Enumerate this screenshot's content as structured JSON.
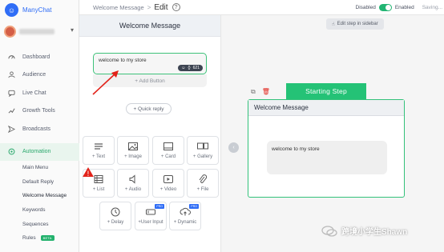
{
  "brand": {
    "name": "ManyChat"
  },
  "sidebar": {
    "nav": [
      {
        "label": "Dashboard",
        "icon": "dashboard-icon"
      },
      {
        "label": "Audience",
        "icon": "audience-icon"
      },
      {
        "label": "Live Chat",
        "icon": "chat-icon"
      },
      {
        "label": "Growth Tools",
        "icon": "growth-icon"
      },
      {
        "label": "Broadcasts",
        "icon": "broadcast-icon"
      },
      {
        "label": "Automation",
        "icon": "automation-icon",
        "active": true
      }
    ],
    "sub_items": [
      {
        "label": "Main Menu"
      },
      {
        "label": "Default Reply"
      },
      {
        "label": "Welcome Message",
        "active": true
      },
      {
        "label": "Keywords"
      },
      {
        "label": "Sequences"
      },
      {
        "label": "Rules",
        "badge": "BETA"
      }
    ]
  },
  "topbar": {
    "flow_name": "Welcome Message",
    "separator": ">",
    "edit_label": "Edit",
    "help_glyph": "?",
    "disabled_label": "Disabled",
    "enabled_label": "Enabled",
    "saving_label": "Saving..."
  },
  "panel": {
    "title": "Welcome Message",
    "message_text": "welcome to my store",
    "char_count": "621",
    "add_button_label": "+ Add Button",
    "quick_reply_label": "+ Quick reply",
    "tiles": [
      {
        "label": "+ Text",
        "icon": "text-icon"
      },
      {
        "label": "+ Image",
        "icon": "image-icon"
      },
      {
        "label": "+ Card",
        "icon": "card-icon"
      },
      {
        "label": "+ Gallery",
        "icon": "gallery-icon"
      },
      {
        "label": "+ List",
        "icon": "list-icon"
      },
      {
        "label": "+ Audio",
        "icon": "audio-icon"
      },
      {
        "label": "+ Video",
        "icon": "video-icon"
      },
      {
        "label": "+ File",
        "icon": "file-icon"
      },
      {
        "label": "+ Delay",
        "icon": "clock-icon"
      },
      {
        "label": "+User Input",
        "icon": "user-input-icon",
        "pro": "PRO"
      },
      {
        "label": "+ Dynamic",
        "icon": "dynamic-icon",
        "pro": "PRO"
      }
    ]
  },
  "canvas": {
    "hint_label": "Edit step in sidebar",
    "start_label": "Starting Step",
    "node_title": "Welcome Message",
    "node_message": "welcome to my store"
  },
  "watermark": {
    "text": "跨境小学生Shawn"
  },
  "colors": {
    "accent": "#22b573",
    "brand": "#2f6df6",
    "arrow": "#e2231a"
  }
}
